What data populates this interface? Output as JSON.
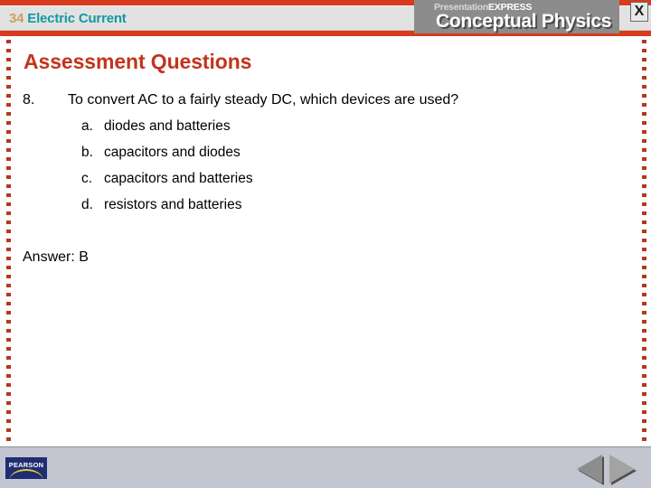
{
  "header": {
    "chapter_number": "34",
    "chapter_name": "Electric Current",
    "brand_presentation": "Presentation",
    "brand_express": "EXPRESS",
    "brand_product": "Conceptual Physics",
    "close_label": "X"
  },
  "slide": {
    "title": "Assessment Questions",
    "question": {
      "number": "8.",
      "text": "To convert AC to a fairly steady DC, which devices are used?",
      "options": [
        {
          "letter": "a.",
          "text": "diodes and batteries"
        },
        {
          "letter": "b.",
          "text": "capacitors and diodes"
        },
        {
          "letter": "c.",
          "text": "capacitors and batteries"
        },
        {
          "letter": "d.",
          "text": "resistors and batteries"
        }
      ]
    },
    "answer": "Answer: B"
  },
  "footer": {
    "publisher_logo_text": "PEARSON",
    "prev_label": "Previous slide",
    "next_label": "Next slide"
  },
  "colors": {
    "banner_red": "#d83a1e",
    "title_red": "#c3341c",
    "chapter_number_tan": "#c9a063",
    "chapter_name_teal": "#1499a0",
    "brand_gray": "#8c8c8c",
    "footer_gray": "#c3c5d1",
    "pearson_navy": "#1f2d72",
    "pearson_gold": "#e8c53c",
    "rail_dot_red": "#b5381f"
  }
}
